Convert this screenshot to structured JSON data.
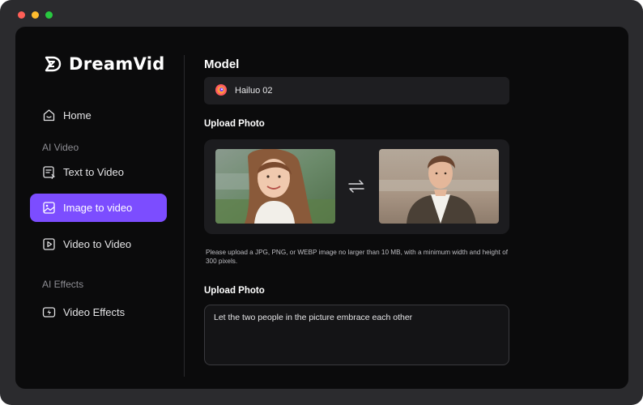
{
  "brand": {
    "name": "DreamVid"
  },
  "sidebar": {
    "home": "Home",
    "section_ai_video": "AI Video",
    "text_to_video": "Text to Video",
    "image_to_video": "Image to video",
    "video_to_video": "Video to Video",
    "section_ai_effects": "AI Effects",
    "video_effects": "Video Effects",
    "active_item": "image_to_video",
    "accent_color": "#7c4dff"
  },
  "main": {
    "model_heading": "Model",
    "model_value": "Hailuo 02",
    "upload_heading": "Upload Photo",
    "upload_note": "Please upload a JPG, PNG, or WEBP image no larger than 10 MB, with a minimum width and height of 300 pixels.",
    "prompt_heading": "Upload Photo",
    "prompt_text": "Let the two people in the picture embrace each other"
  }
}
